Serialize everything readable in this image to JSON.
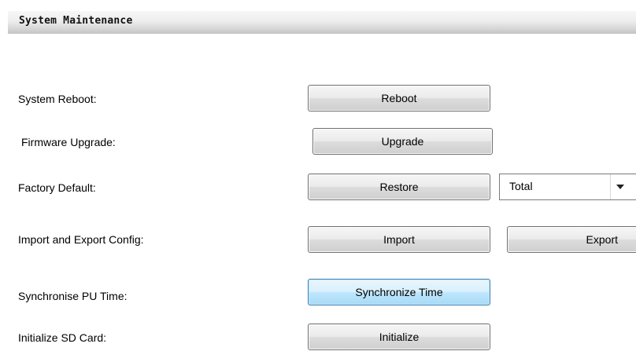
{
  "header": {
    "title": "System Maintenance"
  },
  "rows": {
    "reboot": {
      "label": "System Reboot:",
      "button": "Reboot"
    },
    "upgrade": {
      "label": "Firmware Upgrade:",
      "button": "Upgrade"
    },
    "factory": {
      "label": "Factory Default:",
      "button": "Restore",
      "select_value": "Total"
    },
    "config": {
      "label": "Import and Export Config:",
      "import_button": "Import",
      "export_button": "Export"
    },
    "sync": {
      "label": "Synchronise PU Time:",
      "button": "Synchronize Time"
    },
    "sdcard": {
      "label": "Initialize SD Card:",
      "button": "Initialize"
    }
  },
  "icons": {
    "select_arrow": "chevron-down-icon"
  },
  "colors": {
    "focused_button_border": "#3c7fb1",
    "header_gradient_bottom": "#c6c6c6"
  }
}
